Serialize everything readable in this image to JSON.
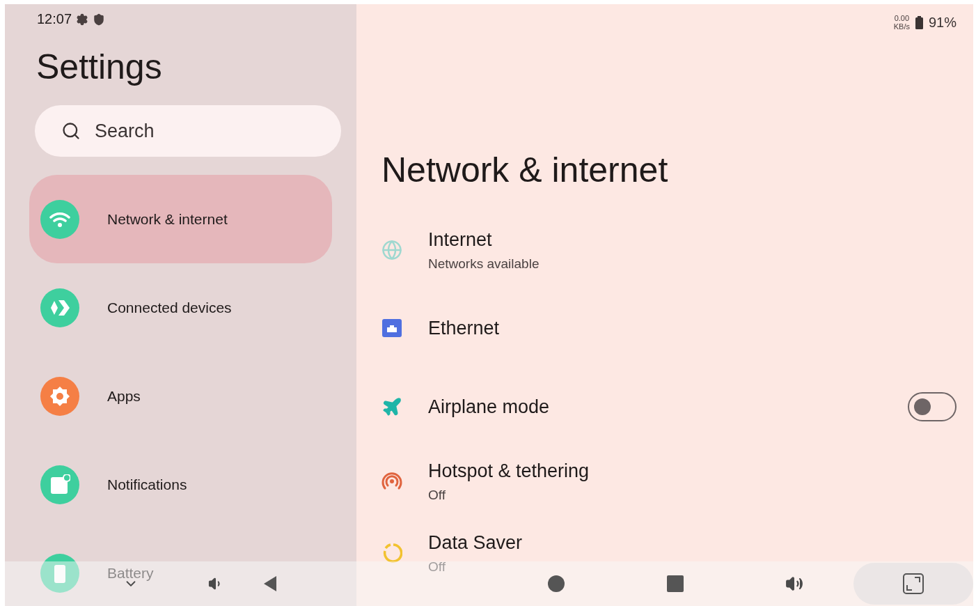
{
  "status_bar": {
    "time": "12:07",
    "net_speed": "0.00",
    "net_unit": "KB/s",
    "battery": "91%"
  },
  "sidebar": {
    "title": "Settings",
    "search": {
      "placeholder": "Search"
    },
    "items": [
      {
        "label": "Network & internet",
        "selected": true
      },
      {
        "label": "Connected devices",
        "selected": false
      },
      {
        "label": "Apps",
        "selected": false
      },
      {
        "label": "Notifications",
        "selected": false
      },
      {
        "label": "Battery",
        "selected": false
      }
    ]
  },
  "main": {
    "title": "Network & internet",
    "items": [
      {
        "kind": "link",
        "title": "Internet",
        "summary": "Networks available"
      },
      {
        "kind": "link",
        "title": "Ethernet"
      },
      {
        "kind": "toggle",
        "title": "Airplane mode",
        "on": false
      },
      {
        "kind": "link",
        "title": "Hotspot & tethering",
        "summary": "Off"
      },
      {
        "kind": "link",
        "title": "Data Saver",
        "summary": "Off"
      }
    ]
  }
}
